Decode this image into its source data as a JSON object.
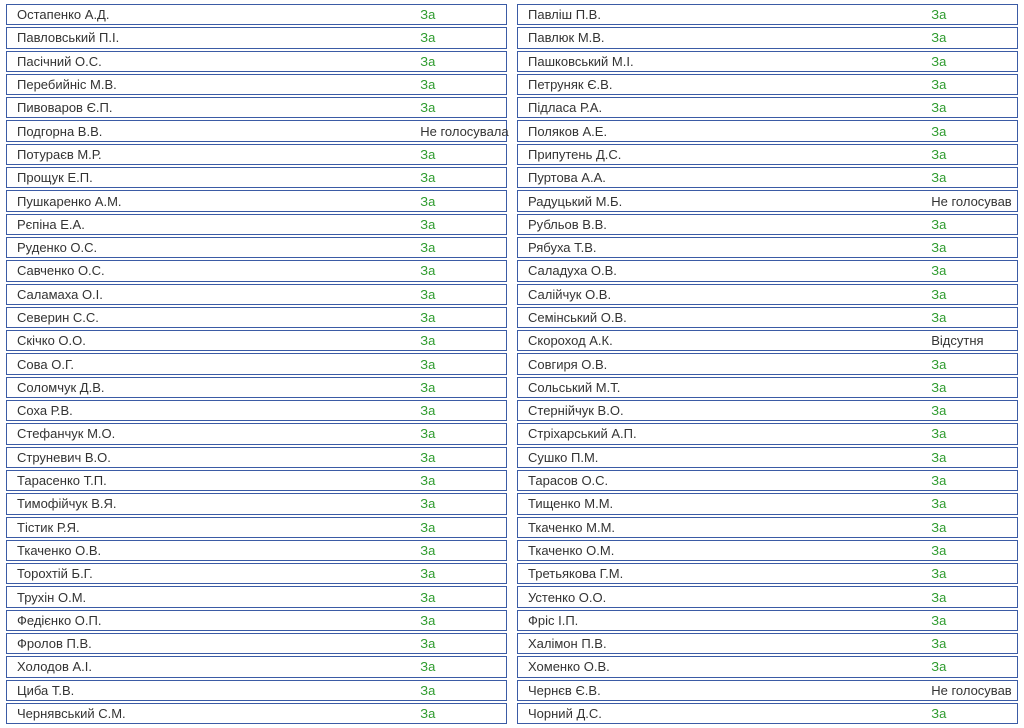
{
  "vote_labels": {
    "za": "За",
    "no_vote_f": "Не голосувала",
    "no_vote_m": "Не голосував",
    "absent_f": "Відсутня"
  },
  "left": [
    {
      "name": "Остапенко А.Д.",
      "vote": "za"
    },
    {
      "name": "Павловський П.І.",
      "vote": "za"
    },
    {
      "name": "Пасічний О.С.",
      "vote": "za"
    },
    {
      "name": "Перебийніс М.В.",
      "vote": "za"
    },
    {
      "name": "Пивоваров Є.П.",
      "vote": "za"
    },
    {
      "name": "Подгорна В.В.",
      "vote": "no_vote_f"
    },
    {
      "name": "Потураєв М.Р.",
      "vote": "za"
    },
    {
      "name": "Прощук Е.П.",
      "vote": "za"
    },
    {
      "name": "Пушкаренко А.М.",
      "vote": "za"
    },
    {
      "name": "Рєпіна Е.А.",
      "vote": "za"
    },
    {
      "name": "Руденко О.С.",
      "vote": "za"
    },
    {
      "name": "Савченко О.С.",
      "vote": "za"
    },
    {
      "name": "Саламаха О.І.",
      "vote": "za"
    },
    {
      "name": "Северин С.С.",
      "vote": "za"
    },
    {
      "name": "Скічко О.О.",
      "vote": "za"
    },
    {
      "name": "Сова О.Г.",
      "vote": "za"
    },
    {
      "name": "Соломчук Д.В.",
      "vote": "za"
    },
    {
      "name": "Соха Р.В.",
      "vote": "za"
    },
    {
      "name": "Стефанчук М.О.",
      "vote": "za"
    },
    {
      "name": "Струневич В.О.",
      "vote": "za"
    },
    {
      "name": "Тарасенко Т.П.",
      "vote": "za"
    },
    {
      "name": "Тимофійчук В.Я.",
      "vote": "za"
    },
    {
      "name": "Тістик Р.Я.",
      "vote": "za"
    },
    {
      "name": "Ткаченко О.В.",
      "vote": "za"
    },
    {
      "name": "Торохтій Б.Г.",
      "vote": "za"
    },
    {
      "name": "Трухін О.М.",
      "vote": "za"
    },
    {
      "name": "Федієнко О.П.",
      "vote": "za"
    },
    {
      "name": "Фролов П.В.",
      "vote": "za"
    },
    {
      "name": "Холодов А.І.",
      "vote": "za"
    },
    {
      "name": "Циба Т.В.",
      "vote": "za"
    },
    {
      "name": "Чернявський С.М.",
      "vote": "za"
    }
  ],
  "right": [
    {
      "name": "Павліш П.В.",
      "vote": "za"
    },
    {
      "name": "Павлюк М.В.",
      "vote": "za"
    },
    {
      "name": "Пашковський М.І.",
      "vote": "za"
    },
    {
      "name": "Петруняк Є.В.",
      "vote": "za"
    },
    {
      "name": "Підласа Р.А.",
      "vote": "za"
    },
    {
      "name": "Поляков А.Е.",
      "vote": "za"
    },
    {
      "name": "Припутень Д.С.",
      "vote": "za"
    },
    {
      "name": "Пуртова А.А.",
      "vote": "za"
    },
    {
      "name": "Радуцький М.Б.",
      "vote": "no_vote_m"
    },
    {
      "name": "Рубльов В.В.",
      "vote": "za"
    },
    {
      "name": "Рябуха Т.В.",
      "vote": "za"
    },
    {
      "name": "Саладуха О.В.",
      "vote": "za"
    },
    {
      "name": "Салійчук О.В.",
      "vote": "za"
    },
    {
      "name": "Семінський О.В.",
      "vote": "za"
    },
    {
      "name": "Скороход А.К.",
      "vote": "absent_f"
    },
    {
      "name": "Совгиря О.В.",
      "vote": "za"
    },
    {
      "name": "Сольський М.Т.",
      "vote": "za"
    },
    {
      "name": "Стернійчук В.О.",
      "vote": "za"
    },
    {
      "name": "Стріхарський А.П.",
      "vote": "za"
    },
    {
      "name": "Сушко П.М.",
      "vote": "za"
    },
    {
      "name": "Тарасов О.С.",
      "vote": "za"
    },
    {
      "name": "Тищенко М.М.",
      "vote": "za"
    },
    {
      "name": "Ткаченко М.М.",
      "vote": "za"
    },
    {
      "name": "Ткаченко О.М.",
      "vote": "za"
    },
    {
      "name": "Третьякова Г.М.",
      "vote": "za"
    },
    {
      "name": "Устенко О.О.",
      "vote": "za"
    },
    {
      "name": "Фріс І.П.",
      "vote": "za"
    },
    {
      "name": "Халімон П.В.",
      "vote": "za"
    },
    {
      "name": "Хоменко О.В.",
      "vote": "za"
    },
    {
      "name": "Чернєв Є.В.",
      "vote": "no_vote_m"
    },
    {
      "name": "Чорний Д.С.",
      "vote": "za"
    }
  ]
}
